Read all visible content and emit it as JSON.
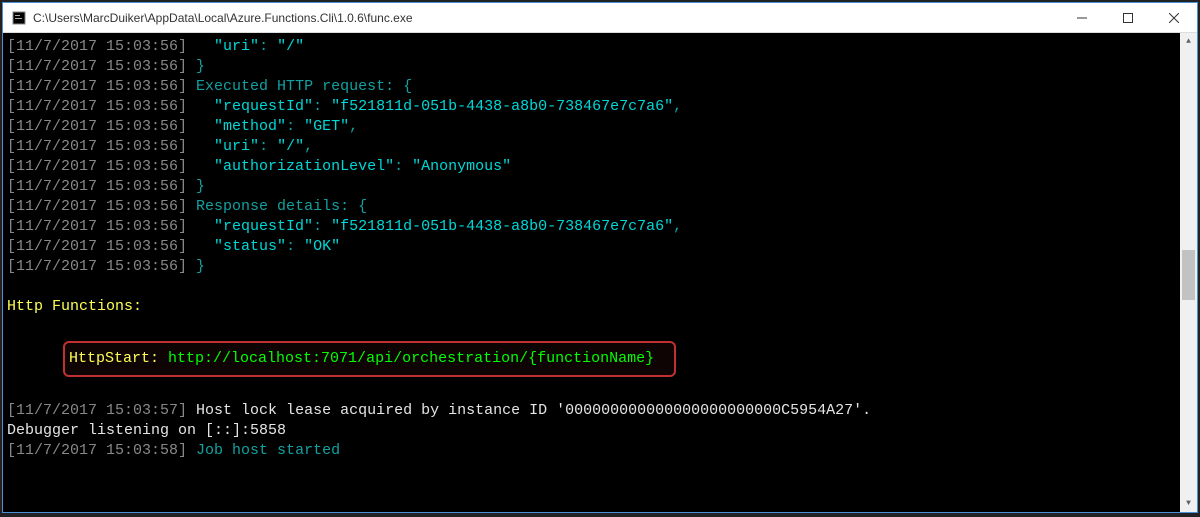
{
  "window": {
    "title": "C:\\Users\\MarcDuiker\\AppData\\Local\\Azure.Functions.Cli\\1.0.6\\func.exe"
  },
  "terminal": {
    "ts1": "[11/7/2017 15:03:56]",
    "ts2": "[11/7/2017 15:03:57]",
    "ts3": "[11/7/2017 15:03:58]",
    "uri_key": "\"uri\"",
    "uri_val": "\"/\"",
    "close_brace": "}",
    "open_brace": "{",
    "executed": "Executed HTTP request:",
    "req_key": "\"requestId\"",
    "req_val": "\"f521811d-051b-4438-a8b0-738467e7c7a6\"",
    "method_key": "\"method\"",
    "method_val": "\"GET\"",
    "auth_key": "\"authorizationLevel\"",
    "auth_val": "\"Anonymous\"",
    "response": "Response details:",
    "status_key": "\"status\"",
    "status_val": "\"OK\"",
    "http_functions": "Http Functions:",
    "http_start_label": "HttpStart: ",
    "http_start_url": "http://localhost:7071/api/orchestration/{functionName}",
    "hostlock": "Host lock lease acquired by instance ID '000000000000000000000000C5954A27'.",
    "debugger": "Debugger listening on [::]:5858",
    "jobhost": "Job host started"
  }
}
